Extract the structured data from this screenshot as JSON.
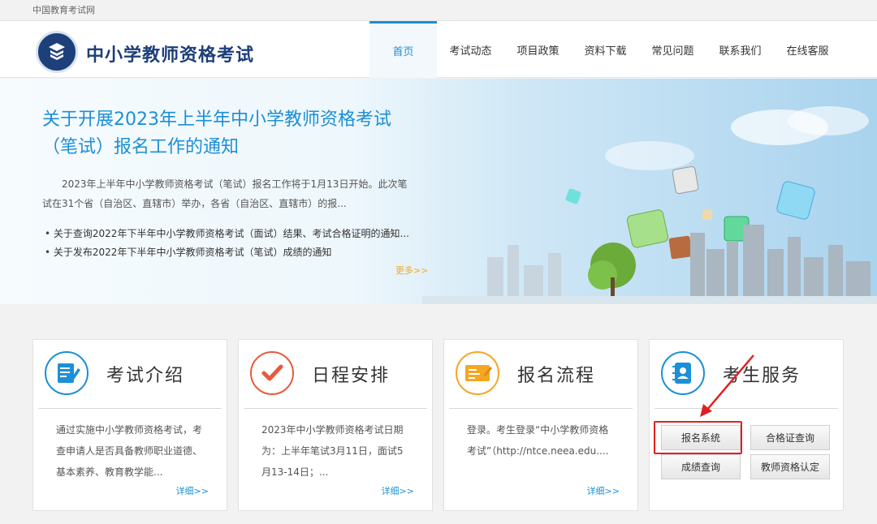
{
  "topbar": {
    "site_link": "中国教育考试网"
  },
  "header": {
    "title": "中小学教师资格考试",
    "nav": [
      {
        "label": "首页",
        "active": true
      },
      {
        "label": "考试动态"
      },
      {
        "label": "项目政策"
      },
      {
        "label": "资料下载"
      },
      {
        "label": "常见问题"
      },
      {
        "label": "联系我们"
      },
      {
        "label": "在线客服"
      }
    ]
  },
  "banner": {
    "title": "关于开展2023年上半年中小学教师资格考试（笔试）报名工作的通知",
    "description": "2023年上半年中小学教师资格考试（笔试）报名工作将于1月13日开始。此次笔试在31个省（自治区、直辖市）举办，各省（自治区、直辖市）的报...",
    "links": [
      "关于查询2022年下半年中小学教师资格考试（面试）结果、考试合格证明的通知...",
      "关于发布2022年下半年中小学教师资格考试（笔试）成绩的通知"
    ],
    "more": "更多>>"
  },
  "cards": [
    {
      "title": "考试介绍",
      "desc": "通过实施中小学教师资格考试，考查申请人是否具备教师职业道德、基本素养、教育教学能...",
      "more": "详细>>",
      "icon": "document-edit-icon"
    },
    {
      "title": "日程安排",
      "desc": "2023年中小学教师资格考试日期为：上半年笔试3月11日，面试5月13-14日；...",
      "more": "详细>>",
      "icon": "checkmark-icon"
    },
    {
      "title": "报名流程",
      "desc": "登录。考生登录“中小学教师资格考试”（http://ntce.neea.edu....",
      "more": "详细>>",
      "icon": "registration-form-icon"
    },
    {
      "title": "考生服务",
      "icon": "contact-book-icon"
    }
  ],
  "services": {
    "registration": "报名系统",
    "certificate_query": "合格证查询",
    "score_query": "成绩查询",
    "teacher_cert": "教师资格认定"
  },
  "colors": {
    "brand": "#1d3f7a",
    "accent": "#1c8fd6",
    "more": "#f5a623",
    "highlight": "#e02020"
  }
}
